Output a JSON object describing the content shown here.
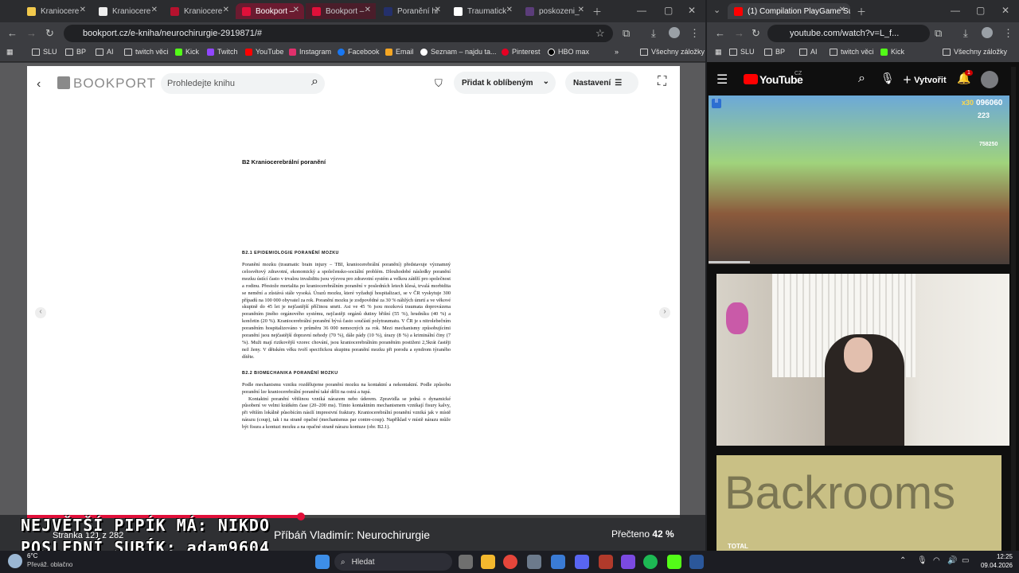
{
  "left_browser": {
    "tabs": [
      "Kraniocere",
      "Kraniocere",
      "Kraniocere",
      "Bookport –",
      "Bookport –",
      "Poranění hl",
      "Traumatick",
      "poskozeni_"
    ],
    "url": "bookport.cz/e-kniha/neurochirurgie-2919871/#",
    "bookmarks": [
      "SLU",
      "BP",
      "AI",
      "twitch věci",
      "Kick",
      "Twitch",
      "YouTube",
      "Instagram",
      "Facebook",
      "Email",
      "Seznam – najdu ta...",
      "Pinterest",
      "HBO max"
    ],
    "bookmarks_more": "»",
    "all_bookmarks": "Všechny záložky",
    "colors": {
      "accent": "#e0103a",
      "tab_bg": "#2b2c2f"
    }
  },
  "bookport": {
    "logo": "BOOKPORT",
    "search_placeholder": "Prohledejte knihu",
    "favorite_label": "Přidat k oblíbeným",
    "settings_label": "Nastavení",
    "book_title": "Příbáň Vladimír: Neurochirurgie",
    "read_label": "Přečteno",
    "read_percent": "42 %",
    "progress_fraction": 0.42,
    "page_label": "Stránka 121 z 282",
    "doc": {
      "chapter": "B2  Kraniocerebrální poranění",
      "sec1_title": "B2.1 EPIDEMIOLOGIE PORANĚNÍ MOZKU",
      "sec1_text": "Poranění mozku (traumatic brain injury – TBI, kraniocerebrální poranění) představuje významný celosvětový zdravotní, ekonomický a společensko-sociální problém. Dlouhodobé následky poranění mozku ústící často v trvalou invaliditu jsou výzvou pro zdravotní systém a velkou zátěží pro společnost a rodinu. Přestože mortalita po kraniocerebrálním poranění v posledních letech klesá, trvalá morbidita se nemění a zůstává stále vysoká. Úrazů mozku, které vyžadují hospitalizaci, se v ČR vyskytuje 300 případů na 100 000 obyvatel za rok. Poranění mozku je zodpovědné za 30 % náhlých úmrtí a ve věkové skupině do 45 let je nejčastější příčinou smrti. Asi ve 45 % jsou mozková traumata doprovázena poraněním jiného orgánového systému, nejčastěji orgánů dutiny břišní (55 %), hrudníku (40 %) a končetin (20 %). Kraniocerebrální poranění bývá často součástí polytraumatu. V ČR je s nitrolebečním poraněním hospitalizováno v průměru 36 000 nemocných za rok. Mezi mechanismy způsobujícími poranění jsou nejčastější dopravní nehody (70 %), dále pády (10 %), úrazy (8 %) a kriminální činy (7 %). Muži mají rizikovější vzorec chování, jsou kraniocerebrálním poraněním postiženi 2,5krát častěji než ženy. V dětském věku tvoří specifickou skupinu poranění mozku při porodu a syndrom týraného dítěte.",
      "sec2_title": "B2.2 BIOMECHANIKA PORANĚNÍ MOZKU",
      "sec2_text1": "Podle mechanismu vzniku rozdělujeme poranění mozku na kontaktní a nekontaktní. Podle způsobu poranění lze kraniocerebrální poranění také dělit na ostrá a tupá.",
      "sec2_text2": "Kontaktní poranění většinou vzniká nárazem nebo úderem. Zpravidla se jedná o dynamické působení ve velmi krátkém čase (20–200 ms). Tímto kontaktním mechanismem vznikají fisury kalvy, při větším lokálně působícím násilí impresivní fraktury. Kraniocerebrální poranění vzniká jak v místě nárazu (coup), tak i na straně opačné (mechanismus par contre-coup). Například v místě nárazu může být fisura a kontuzi mozku a na opačné straně nárazu kontuze (obr. B2.1)."
    }
  },
  "stream_overlay": {
    "line1": "NEJVĚTŠÍ PIPÍK MÁ: NIKDO",
    "line2": "POSLEDNÍ SUBÍK: adam9604"
  },
  "right_browser": {
    "tab_title": "(1) Compilation PlayGame Sub...",
    "url": "youtube.com/watch?v=L_f...",
    "bookmarks": [
      "SLU",
      "BP",
      "AI",
      "twitch věci",
      "Kick"
    ],
    "all_bookmarks": "Všechny záložky",
    "yt_logo": "YouTube",
    "yt_region": "CZ",
    "create_label": "Vytvořit",
    "notif_count": "1",
    "game_score": "096060",
    "game_mult": "x30",
    "game_coins": "223",
    "game_side": "758250",
    "card_title": "Backrooms",
    "card_sub": "TOTAL"
  },
  "taskbar": {
    "weather_temp": "6°C",
    "weather_desc": "Převáž. oblačno",
    "search_label": "Hledat",
    "time": "12:25",
    "date": "09.04.2026"
  }
}
